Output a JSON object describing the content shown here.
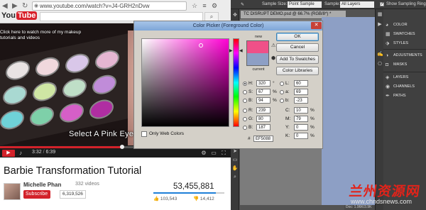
{
  "browser": {
    "url": "www.youtube.com/watch?v=J4-GRH2nDvw",
    "logo_you": "You",
    "logo_tube": "Tube"
  },
  "video": {
    "overlay_line1": "Click here to watch more of my makeup",
    "overlay_line2": "tutorials and videos",
    "caption": "Select A Pink Eyeshad",
    "time_current": "3:32",
    "time_total": "6:39",
    "progress": 0.53
  },
  "info": {
    "title": "Barbie Transformation Tutorial",
    "channel": "Michelle Phan",
    "channel_videos": "332 videos",
    "subscribe_label": "Subscribe",
    "subscriber_count": "6,319,526",
    "views": "53,455,881",
    "likes": "103,543",
    "dislikes": "14,412",
    "like_ratio": 0.88
  },
  "photoshop": {
    "options": {
      "sample_size_label": "Sample Size:",
      "sample_size_value": "Point Sample",
      "sample_label": "Sample:",
      "sample_value": "All Layers",
      "sampling_ring_label": "Show Sampling Ring",
      "sampling_ring_checked": true
    },
    "doc_tab": "TC DISRUPT DEMO.psd @ 66.7% (RGB/8*) *",
    "status": "Doc: 1.96K/3.9K",
    "panels": {
      "color": "COLOR",
      "swatches": "SWATCHES",
      "styles": "STYLES",
      "adjustments": "ADJUSTMENTS",
      "masks": "MASKS",
      "layers": "LAYERS",
      "channels": "CHANNELS",
      "paths": "PATHS"
    }
  },
  "picker": {
    "title": "Color Picker (Foreground Color)",
    "new_label": "new",
    "current_label": "current",
    "new_color": "#EF5088",
    "current_color": "#8d9fc5",
    "buttons": {
      "ok": "OK",
      "cancel": "Cancel",
      "add_to_swatches": "Add To Swatches",
      "color_libraries": "Color Libraries"
    },
    "web_only_label": "Only Web Colors",
    "fields": {
      "H": "320",
      "H_unit": "°",
      "S": "67",
      "S_unit": "%",
      "B": "94",
      "B_unit": "%",
      "R": "239",
      "G": "80",
      "Bl": "187",
      "L": "60",
      "a": "69",
      "b": "-23",
      "C": "10",
      "C_unit": "%",
      "M": "79",
      "M_unit": "%",
      "Y": "0",
      "Y_unit": "%",
      "K": "0",
      "K_unit": "%"
    },
    "hex": "EF5088"
  },
  "watermark": {
    "cn": "兰州资源网",
    "url": "www.chndsnews.com"
  }
}
